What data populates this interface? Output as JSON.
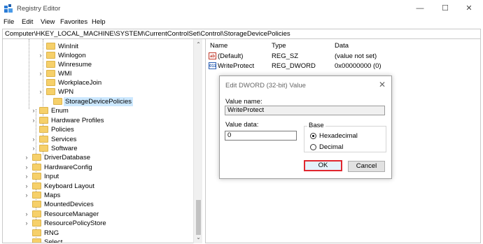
{
  "window": {
    "title": "Registry Editor",
    "controls": {
      "minimize": "—",
      "maximize": "☐",
      "close": "✕"
    }
  },
  "menu": [
    "File",
    "Edit",
    "View",
    "Favorites",
    "Help"
  ],
  "address": "Computer\\HKEY_LOCAL_MACHINE\\SYSTEM\\CurrentControlSet\\Control\\StorageDevicePolicies",
  "tree": [
    {
      "label": "WinInit",
      "expandable": false
    },
    {
      "label": "Winlogon",
      "expandable": true
    },
    {
      "label": "Winresume",
      "expandable": false
    },
    {
      "label": "WMI",
      "expandable": true
    },
    {
      "label": "WorkplaceJoin",
      "expandable": false
    },
    {
      "label": "WPN",
      "expandable": true
    },
    {
      "label": "StorageDevicePolicies",
      "expandable": false,
      "selected": true
    },
    {
      "label": "Enum",
      "expandable": true
    },
    {
      "label": "Hardware Profiles",
      "expandable": true
    },
    {
      "label": "Policies",
      "expandable": false
    },
    {
      "label": "Services",
      "expandable": true
    },
    {
      "label": "Software",
      "expandable": true
    },
    {
      "label": "DriverDatabase",
      "expandable": true
    },
    {
      "label": "HardwareConfig",
      "expandable": true
    },
    {
      "label": "Input",
      "expandable": true
    },
    {
      "label": "Keyboard Layout",
      "expandable": true
    },
    {
      "label": "Maps",
      "expandable": true
    },
    {
      "label": "MountedDevices",
      "expandable": false
    },
    {
      "label": "ResourceManager",
      "expandable": true
    },
    {
      "label": "ResourcePolicyStore",
      "expandable": true
    },
    {
      "label": "RNG",
      "expandable": false
    },
    {
      "label": "Select",
      "expandable": false
    }
  ],
  "list": {
    "headers": {
      "name": "Name",
      "type": "Type",
      "data": "Data"
    },
    "rows": [
      {
        "name": "(Default)",
        "type": "REG_SZ",
        "data": "(value not set)",
        "icon": "ab",
        "icon_color": "#c0392b"
      },
      {
        "name": "WriteProtect",
        "type": "REG_DWORD",
        "data": "0x00000000 (0)",
        "icon": "011",
        "icon_color": "#2b5fb3"
      }
    ]
  },
  "dialog": {
    "title": "Edit DWORD (32-bit) Value",
    "close": "✕",
    "value_name_label": "Value name:",
    "value_name": "WriteProtect",
    "value_data_label": "Value data:",
    "value_data": "0",
    "base_label": "Base",
    "hex_label": "Hexadecimal",
    "dec_label": "Decimal",
    "selected_base": "Hexadecimal",
    "ok": "OK",
    "cancel": "Cancel"
  },
  "colors": {
    "selection": "#cce8ff",
    "highlight_border": "#e0272f",
    "folder": "#f6d06a"
  }
}
